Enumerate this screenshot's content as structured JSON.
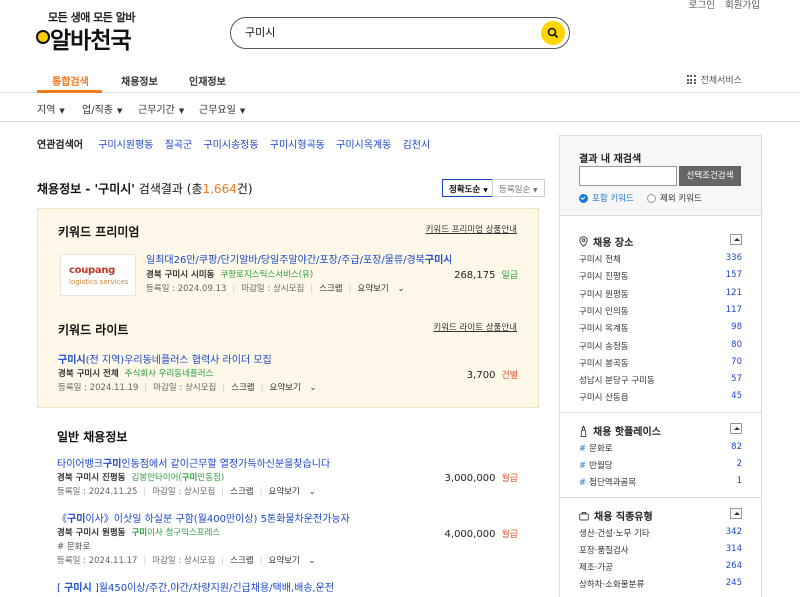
{
  "header": {
    "logo_tagline": "모든 생애 모든 알바",
    "logo_name": "알바천국",
    "top_links": [
      "로그인",
      "회원가입"
    ],
    "search_value": "구미시"
  },
  "tabs": {
    "items": [
      "통합검색",
      "채용정보",
      "인재정보"
    ],
    "all_services": "전체서비스"
  },
  "filters": [
    "지역",
    "업/직종",
    "근무기간",
    "근무요일"
  ],
  "related": {
    "label": "연관검색어",
    "keywords": [
      "구미시원평동",
      "칠곡군",
      "구미시송정동",
      "구미시형곡동",
      "구미시옥계동",
      "김천시"
    ]
  },
  "results": {
    "title_prefix": "채용정보 - '구미시'",
    "title_mid": " 검색결과 (총",
    "count": "1,664",
    "title_suffix": "건)",
    "sort_active": "정확도순",
    "sort_other": "등록일순"
  },
  "premium": {
    "title": "키워드 프리미엄",
    "link": "키워드 프리미엄 상품안내",
    "logo_line1": "coupang",
    "logo_line2": "logistics services",
    "job": {
      "title_pre": "일최대26만/쿠팡/단기알바/당일주말야간/포장/주급/포장/물류/경북",
      "title_bold": "구미시",
      "title_post": "...",
      "loc": "경북 구미시 시미동",
      "company": "쿠팡로지스틱스서비스(유)",
      "pay": "268,175",
      "pay_unit": "일급",
      "date": "등록일 : 2024.09.13",
      "deadline": "마감일 : 상시모집",
      "scrap": "스크랩",
      "summary": "요약보기"
    }
  },
  "lite": {
    "title": "키워드 라이트",
    "link": "키워드 라이트 상품안내",
    "job": {
      "title_bold": "구미시",
      "title_post": "(전 지역)우리동네플러스 협력사 라이더 모집",
      "loc": "경북 구미시 전체",
      "company": "주식회사 우리동네플러스",
      "pay": "3,700",
      "pay_unit": "건별",
      "date": "등록일 : 2024.11.19",
      "deadline": "마감일 : 상시모집",
      "scrap": "스크랩",
      "summary": "요약보기"
    }
  },
  "general": {
    "title": "일반 채용정보",
    "jobs": [
      {
        "title_pre": "타이어뱅크",
        "title_bold": "구미",
        "title_post": "인동점에서 같이근무할 열정가득하신분을찾습니다",
        "loc": "경북 구미시 진평동",
        "company_pre": "김봉만타이어(",
        "company_bold": "구미",
        "company_post": "인동점)",
        "pay": "3,000,000",
        "pay_unit": "월급",
        "date": "등록일 : 2024.11.25",
        "deadline": "마감일 : 상시모집",
        "scrap": "스크랩",
        "summary": "요약보기"
      },
      {
        "title_pre": "《",
        "title_bold": "구미",
        "title_post": "이사》이삿일 하실분 구함(월400만이상) 5톤화물차운전가능자",
        "loc": "경북 구미시 원평동",
        "company_pre": "",
        "company_bold": "구미",
        "company_post": "이사 청구익스프레스",
        "tag": "# 문화로",
        "pay": "4,000,000",
        "pay_unit": "월급",
        "date": "등록일 : 2024.11.17",
        "deadline": "마감일 : 상시모집",
        "scrap": "스크랩",
        "summary": "요약보기"
      },
      {
        "title_pre": "[ ",
        "title_bold": "구미시",
        "title_post": " ]월450이상/주간,야간/차량지원/긴급채용/택배,배송,운전"
      }
    ]
  },
  "sidebar": {
    "refine_title": "결과 내 재검색",
    "refine_button": "선택조건검색",
    "include_label": "포함 키워드",
    "exclude_label": "제외 키워드",
    "location_title": "채용 장소",
    "locations": [
      {
        "name": "구미시 전체",
        "count": "336"
      },
      {
        "name": "구미시 진평동",
        "count": "157"
      },
      {
        "name": "구미시 원평동",
        "count": "121"
      },
      {
        "name": "구미시 인의동",
        "count": "117"
      },
      {
        "name": "구미시 옥계동",
        "count": "98"
      },
      {
        "name": "구미시 송정동",
        "count": "80"
      },
      {
        "name": "구미시 봉곡동",
        "count": "70"
      },
      {
        "name": "성남시 분당구 구미동",
        "count": "57"
      },
      {
        "name": "구미시 산동읍",
        "count": "45"
      }
    ],
    "hotplace_title": "채용 핫플레이스",
    "hotplaces": [
      {
        "name": "문화로",
        "count": "82"
      },
      {
        "name": "반월당",
        "count": "2"
      },
      {
        "name": "첨단역과골목",
        "count": "1"
      }
    ],
    "jobtype_title": "채용 직종유형",
    "jobtypes": [
      {
        "name": "생산·건설·노무 기타",
        "count": "342"
      },
      {
        "name": "포장·품질검사",
        "count": "314"
      },
      {
        "name": "제조·가공",
        "count": "264"
      },
      {
        "name": "상하차·소화물분류",
        "count": "245"
      }
    ]
  }
}
